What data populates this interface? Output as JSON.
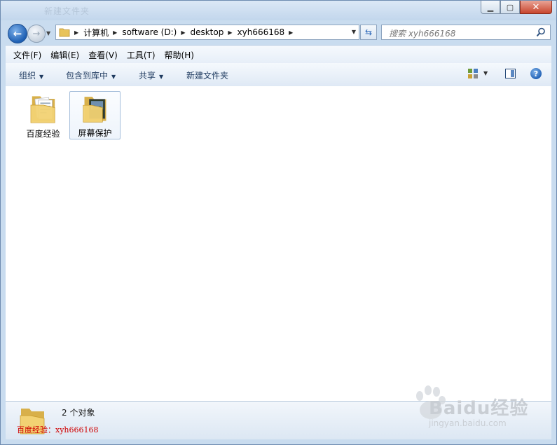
{
  "window": {
    "title": "新建文件夹"
  },
  "address": {
    "crumbs": [
      "计算机",
      "software (D:)",
      "desktop",
      "xyh666168"
    ]
  },
  "search": {
    "placeholder": "搜索 xyh666168"
  },
  "menu": [
    "文件(F)",
    "编辑(E)",
    "查看(V)",
    "工具(T)",
    "帮助(H)"
  ],
  "commands": {
    "organize": "组织",
    "include_library": "包含到库中",
    "share": "共享",
    "new_folder": "新建文件夹"
  },
  "items": [
    {
      "label": "百度经验",
      "icon": "folder-with-documents-icon",
      "selected": false
    },
    {
      "label": "屏幕保护",
      "icon": "folder-with-pictures-icon",
      "selected": true
    }
  ],
  "status": {
    "count": "2 个对象"
  },
  "watermark": {
    "red_text": "百度经验：xyh666168",
    "brand": "Baidu经验",
    "sub": "jingyan.baidu.com"
  },
  "colors": {
    "accent": "#1e5fb3",
    "frame": "#c9dcef",
    "selection": "#a6bfdb",
    "watermark_red": "#d00000"
  }
}
